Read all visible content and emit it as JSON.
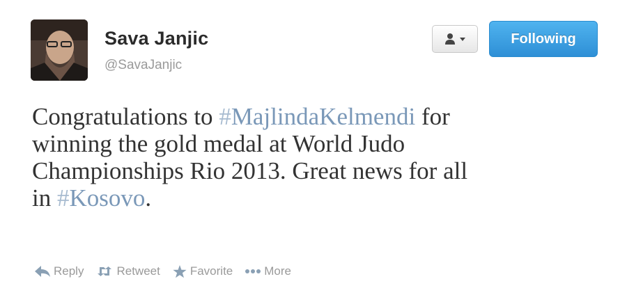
{
  "user": {
    "name": "Sava Janjic",
    "handle": "@SavaJanjic",
    "avatar_icon": "profile-photo"
  },
  "buttons": {
    "user_menu_icon": "person-icon",
    "following_label": "Following",
    "following_color": "#3a9fe0"
  },
  "tweet": {
    "line1_before": "Congratulations to ",
    "hashtag1_symbol": "#",
    "hashtag1_text": "MajlindaKelmendi",
    "line1_after": " for",
    "line2": "winning the gold medal at World Judo",
    "line3": "Championships Rio 2013. Great news for all",
    "line4_before": "in ",
    "hashtag2_symbol": "#",
    "hashtag2_text": "Kosovo",
    "line4_after": ".",
    "hashtag_color": "#7a98b8"
  },
  "actions": [
    {
      "label": "Reply",
      "icon": "reply-arrow-icon"
    },
    {
      "label": "Retweet",
      "icon": "retweet-icon"
    },
    {
      "label": "Favorite",
      "icon": "star-icon"
    },
    {
      "label": "More",
      "icon": "more-dots-icon"
    }
  ]
}
